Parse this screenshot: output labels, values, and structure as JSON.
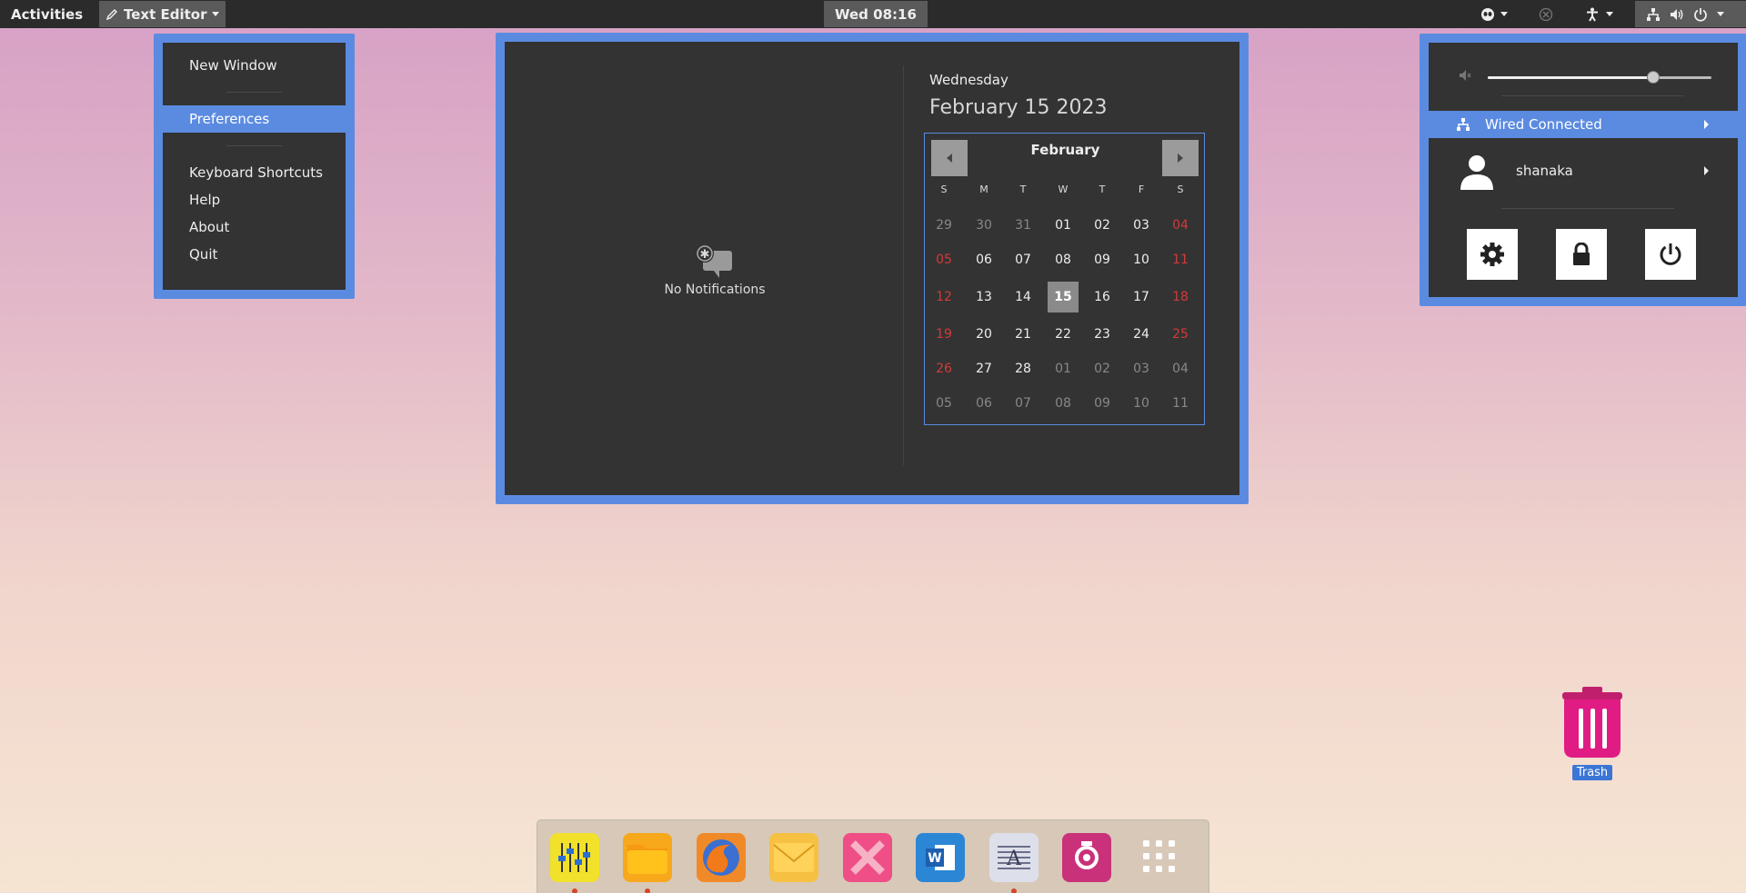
{
  "topbar": {
    "activities": "Activities",
    "app_menu": "Text Editor",
    "clock": "Wed 08:16"
  },
  "app_menu_popup": {
    "items": [
      {
        "label": "New Window"
      },
      {
        "label": "Preferences"
      },
      {
        "label": "Keyboard Shortcuts"
      },
      {
        "label": "Help"
      },
      {
        "label": "About"
      },
      {
        "label": "Quit"
      }
    ]
  },
  "notifications": {
    "empty_label": "No Notifications"
  },
  "calendar": {
    "day_name": "Wednesday",
    "full_date": "February 15 2023",
    "month": "February",
    "weekday_headers": [
      "S",
      "M",
      "T",
      "W",
      "T",
      "F",
      "S"
    ],
    "weeks": [
      [
        "29",
        "30",
        "31",
        "01",
        "02",
        "03",
        "04"
      ],
      [
        "05",
        "06",
        "07",
        "08",
        "09",
        "10",
        "11"
      ],
      [
        "12",
        "13",
        "14",
        "15",
        "16",
        "17",
        "18"
      ],
      [
        "19",
        "20",
        "21",
        "22",
        "23",
        "24",
        "25"
      ],
      [
        "26",
        "27",
        "28",
        "01",
        "02",
        "03",
        "04"
      ],
      [
        "05",
        "06",
        "07",
        "08",
        "09",
        "10",
        "11"
      ]
    ],
    "today": "15"
  },
  "system_menu": {
    "volume_level": 0.74,
    "network_label": "Wired Connected",
    "user_name": "shanaka"
  },
  "desktop": {
    "trash_label": "Trash"
  },
  "dock": {
    "apps": [
      {
        "name": "mixer-app-icon",
        "color": "#f2e12a",
        "running": true
      },
      {
        "name": "files-app-icon",
        "color": "#f7a81b",
        "running": true
      },
      {
        "name": "firefox-app-icon",
        "color": "#f08a28",
        "running": false
      },
      {
        "name": "mail-app-icon",
        "color": "#f6c043",
        "running": false
      },
      {
        "name": "tools-app-icon",
        "color": "#ef4f86",
        "running": false
      },
      {
        "name": "word-app-icon",
        "color": "#2b86d6",
        "running": false
      },
      {
        "name": "text-editor-app-icon",
        "color": "#dde0ea",
        "running": true
      },
      {
        "name": "screenshot-app-icon",
        "color": "#c9317a",
        "running": false
      },
      {
        "name": "app-grid-icon",
        "color": "transparent",
        "running": false
      }
    ]
  }
}
